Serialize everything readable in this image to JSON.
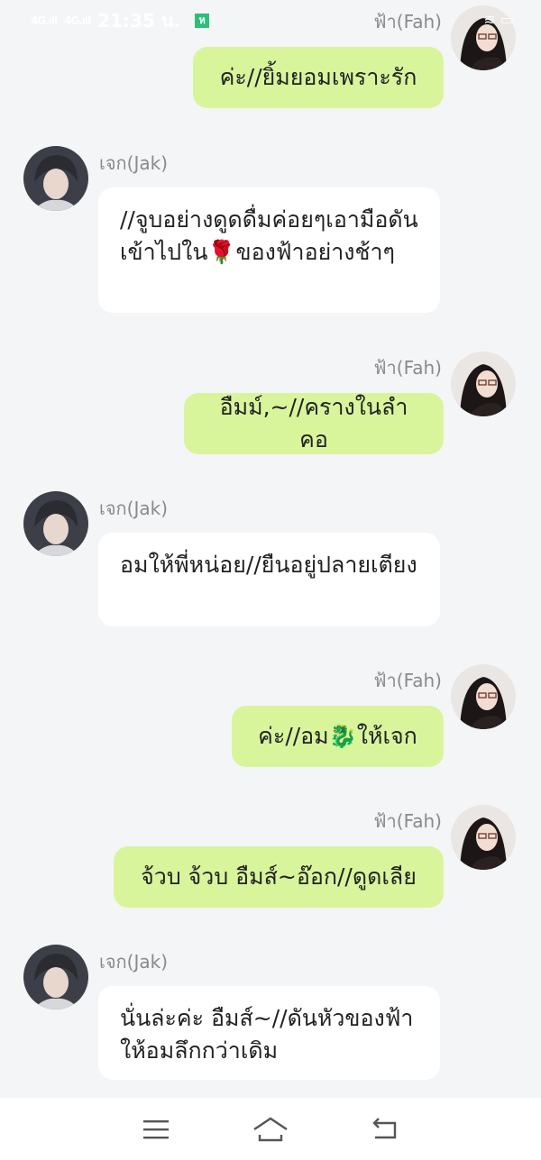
{
  "status_bar": {
    "signal_1": "4G.ıll",
    "signal_2": "4G.ıll",
    "time": "21:35 น.",
    "app_badge": "ห",
    "right_icons": "≋ ▭"
  },
  "messages": [
    {
      "sender": "ฟ้า(Fah)",
      "side": "me",
      "text": "ค่ะ//ยิ้มยอมเพราะรัก"
    },
    {
      "sender": "เจก(Jak)",
      "side": "them",
      "text": "//จูบอย่างดูดดื่มค่อยๆเอามือดันเข้าไปใน🌹ของฟ้าอย่างช้าๆ"
    },
    {
      "sender": "ฟ้า(Fah)",
      "side": "me",
      "text": "อืมม์,~//ครางในลำคอ"
    },
    {
      "sender": "เจก(Jak)",
      "side": "them",
      "text": "อมให้พี่หน่อย//ยืนอยู่ปลายเตียง"
    },
    {
      "sender": "ฟ้า(Fah)",
      "side": "me",
      "text": "ค่ะ//อม🐉ให้เจก"
    },
    {
      "sender": "ฟ้า(Fah)",
      "side": "me",
      "text": "จ้วบ จ้วบ อืมส์~อ๊อก//ดูดเลีย"
    },
    {
      "sender": "เจก(Jak)",
      "side": "them",
      "text": "นั่นล่ะค่ะ อืมส์~//ดันหัวของฟ้าให้อมลึกกว่าเดิม"
    }
  ],
  "nav": {
    "menu_icon": "menu-icon",
    "home_icon": "home-icon",
    "back_icon": "back-icon"
  },
  "colors": {
    "my_bubble": "#d9f59c",
    "their_bubble": "#ffffff",
    "background": "#f4f5f7"
  }
}
